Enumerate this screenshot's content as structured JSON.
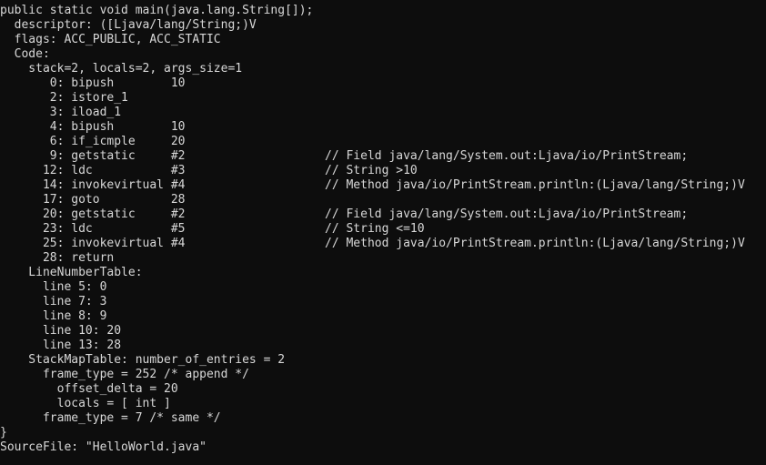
{
  "terminal": {
    "background_color": "#0d0d0d",
    "foreground_color": "#d8d8d8",
    "lines": [
      {
        "text": "public static void main(java.lang.String[]);",
        "comment": ""
      },
      {
        "text": "  descriptor: ([Ljava/lang/String;)V",
        "comment": ""
      },
      {
        "text": "  flags: ACC_PUBLIC, ACC_STATIC",
        "comment": ""
      },
      {
        "text": "  Code:",
        "comment": ""
      },
      {
        "text": "    stack=2, locals=2, args_size=1",
        "comment": ""
      },
      {
        "text": "       0: bipush        10",
        "comment": ""
      },
      {
        "text": "       2: istore_1",
        "comment": ""
      },
      {
        "text": "       3: iload_1",
        "comment": ""
      },
      {
        "text": "       4: bipush        10",
        "comment": ""
      },
      {
        "text": "       6: if_icmple     20",
        "comment": ""
      },
      {
        "text": "       9: getstatic     #2",
        "comment": "// Field java/lang/System.out:Ljava/io/PrintStream;"
      },
      {
        "text": "      12: ldc           #3",
        "comment": "// String >10"
      },
      {
        "text": "      14: invokevirtual #4",
        "comment": "// Method java/io/PrintStream.println:(Ljava/lang/String;)V"
      },
      {
        "text": "      17: goto          28",
        "comment": ""
      },
      {
        "text": "      20: getstatic     #2",
        "comment": "// Field java/lang/System.out:Ljava/io/PrintStream;"
      },
      {
        "text": "      23: ldc           #5",
        "comment": "// String <=10"
      },
      {
        "text": "      25: invokevirtual #4",
        "comment": "// Method java/io/PrintStream.println:(Ljava/lang/String;)V"
      },
      {
        "text": "      28: return",
        "comment": ""
      },
      {
        "text": "    LineNumberTable:",
        "comment": ""
      },
      {
        "text": "      line 5: 0",
        "comment": ""
      },
      {
        "text": "      line 7: 3",
        "comment": ""
      },
      {
        "text": "      line 8: 9",
        "comment": ""
      },
      {
        "text": "      line 10: 20",
        "comment": ""
      },
      {
        "text": "      line 13: 28",
        "comment": ""
      },
      {
        "text": "    StackMapTable: number_of_entries = 2",
        "comment": ""
      },
      {
        "text": "      frame_type = 252 /* append */",
        "comment": ""
      },
      {
        "text": "        offset_delta = 20",
        "comment": ""
      },
      {
        "text": "        locals = [ int ]",
        "comment": ""
      },
      {
        "text": "      frame_type = 7 /* same */",
        "comment": ""
      },
      {
        "text": "}",
        "comment": ""
      },
      {
        "text": "SourceFile: \"HelloWorld.java\"",
        "comment": ""
      }
    ]
  }
}
